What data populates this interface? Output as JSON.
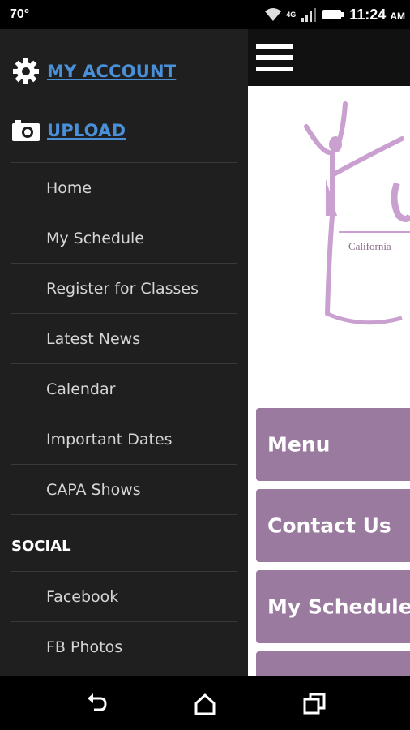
{
  "status_bar": {
    "temperature": "70°",
    "network": "4G",
    "time": "11:24",
    "ampm": "AM"
  },
  "drawer": {
    "my_account": "MY ACCOUNT",
    "upload": "UPLOAD",
    "items": [
      {
        "label": "Home"
      },
      {
        "label": "My Schedule"
      },
      {
        "label": "Register for Classes"
      },
      {
        "label": "Latest News"
      },
      {
        "label": "Calendar"
      },
      {
        "label": "Important Dates"
      },
      {
        "label": "CAPA Shows"
      }
    ],
    "social_header": "SOCIAL",
    "social_items": [
      {
        "label": "Facebook"
      },
      {
        "label": "FB Photos"
      }
    ]
  },
  "main": {
    "logo_text": "California",
    "tiles": [
      {
        "label": "Menu"
      },
      {
        "label": "Contact Us"
      },
      {
        "label": "My Schedule"
      },
      {
        "label": ""
      }
    ]
  },
  "colors": {
    "link": "#4a90d9",
    "drawer_bg": "#1f1f1f",
    "tile": "#9a7a9e",
    "logo_purple": "#c9a0cf"
  },
  "icons": {
    "account": "gear-icon",
    "upload": "camera-icon",
    "menu": "hamburger-icon",
    "back": "back-icon",
    "home": "home-icon",
    "recents": "recents-icon"
  }
}
